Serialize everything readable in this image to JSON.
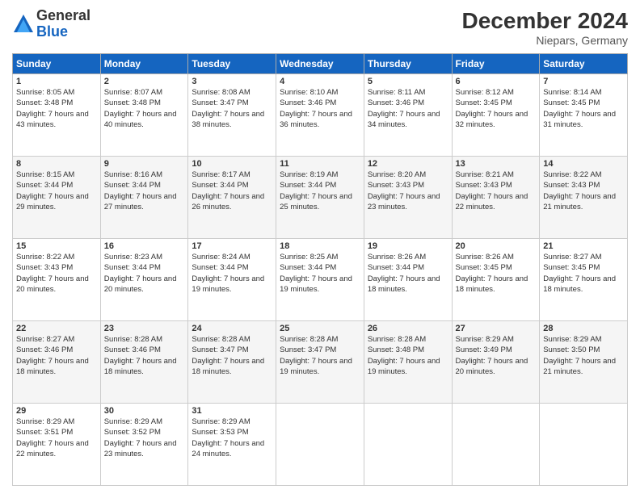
{
  "header": {
    "logo_general": "General",
    "logo_blue": "Blue",
    "month_title": "December 2024",
    "location": "Niepars, Germany"
  },
  "days_of_week": [
    "Sunday",
    "Monday",
    "Tuesday",
    "Wednesday",
    "Thursday",
    "Friday",
    "Saturday"
  ],
  "weeks": [
    [
      {
        "day": "1",
        "sunrise": "Sunrise: 8:05 AM",
        "sunset": "Sunset: 3:48 PM",
        "daylight": "Daylight: 7 hours and 43 minutes."
      },
      {
        "day": "2",
        "sunrise": "Sunrise: 8:07 AM",
        "sunset": "Sunset: 3:48 PM",
        "daylight": "Daylight: 7 hours and 40 minutes."
      },
      {
        "day": "3",
        "sunrise": "Sunrise: 8:08 AM",
        "sunset": "Sunset: 3:47 PM",
        "daylight": "Daylight: 7 hours and 38 minutes."
      },
      {
        "day": "4",
        "sunrise": "Sunrise: 8:10 AM",
        "sunset": "Sunset: 3:46 PM",
        "daylight": "Daylight: 7 hours and 36 minutes."
      },
      {
        "day": "5",
        "sunrise": "Sunrise: 8:11 AM",
        "sunset": "Sunset: 3:46 PM",
        "daylight": "Daylight: 7 hours and 34 minutes."
      },
      {
        "day": "6",
        "sunrise": "Sunrise: 8:12 AM",
        "sunset": "Sunset: 3:45 PM",
        "daylight": "Daylight: 7 hours and 32 minutes."
      },
      {
        "day": "7",
        "sunrise": "Sunrise: 8:14 AM",
        "sunset": "Sunset: 3:45 PM",
        "daylight": "Daylight: 7 hours and 31 minutes."
      }
    ],
    [
      {
        "day": "8",
        "sunrise": "Sunrise: 8:15 AM",
        "sunset": "Sunset: 3:44 PM",
        "daylight": "Daylight: 7 hours and 29 minutes."
      },
      {
        "day": "9",
        "sunrise": "Sunrise: 8:16 AM",
        "sunset": "Sunset: 3:44 PM",
        "daylight": "Daylight: 7 hours and 27 minutes."
      },
      {
        "day": "10",
        "sunrise": "Sunrise: 8:17 AM",
        "sunset": "Sunset: 3:44 PM",
        "daylight": "Daylight: 7 hours and 26 minutes."
      },
      {
        "day": "11",
        "sunrise": "Sunrise: 8:19 AM",
        "sunset": "Sunset: 3:44 PM",
        "daylight": "Daylight: 7 hours and 25 minutes."
      },
      {
        "day": "12",
        "sunrise": "Sunrise: 8:20 AM",
        "sunset": "Sunset: 3:43 PM",
        "daylight": "Daylight: 7 hours and 23 minutes."
      },
      {
        "day": "13",
        "sunrise": "Sunrise: 8:21 AM",
        "sunset": "Sunset: 3:43 PM",
        "daylight": "Daylight: 7 hours and 22 minutes."
      },
      {
        "day": "14",
        "sunrise": "Sunrise: 8:22 AM",
        "sunset": "Sunset: 3:43 PM",
        "daylight": "Daylight: 7 hours and 21 minutes."
      }
    ],
    [
      {
        "day": "15",
        "sunrise": "Sunrise: 8:22 AM",
        "sunset": "Sunset: 3:43 PM",
        "daylight": "Daylight: 7 hours and 20 minutes."
      },
      {
        "day": "16",
        "sunrise": "Sunrise: 8:23 AM",
        "sunset": "Sunset: 3:44 PM",
        "daylight": "Daylight: 7 hours and 20 minutes."
      },
      {
        "day": "17",
        "sunrise": "Sunrise: 8:24 AM",
        "sunset": "Sunset: 3:44 PM",
        "daylight": "Daylight: 7 hours and 19 minutes."
      },
      {
        "day": "18",
        "sunrise": "Sunrise: 8:25 AM",
        "sunset": "Sunset: 3:44 PM",
        "daylight": "Daylight: 7 hours and 19 minutes."
      },
      {
        "day": "19",
        "sunrise": "Sunrise: 8:26 AM",
        "sunset": "Sunset: 3:44 PM",
        "daylight": "Daylight: 7 hours and 18 minutes."
      },
      {
        "day": "20",
        "sunrise": "Sunrise: 8:26 AM",
        "sunset": "Sunset: 3:45 PM",
        "daylight": "Daylight: 7 hours and 18 minutes."
      },
      {
        "day": "21",
        "sunrise": "Sunrise: 8:27 AM",
        "sunset": "Sunset: 3:45 PM",
        "daylight": "Daylight: 7 hours and 18 minutes."
      }
    ],
    [
      {
        "day": "22",
        "sunrise": "Sunrise: 8:27 AM",
        "sunset": "Sunset: 3:46 PM",
        "daylight": "Daylight: 7 hours and 18 minutes."
      },
      {
        "day": "23",
        "sunrise": "Sunrise: 8:28 AM",
        "sunset": "Sunset: 3:46 PM",
        "daylight": "Daylight: 7 hours and 18 minutes."
      },
      {
        "day": "24",
        "sunrise": "Sunrise: 8:28 AM",
        "sunset": "Sunset: 3:47 PM",
        "daylight": "Daylight: 7 hours and 18 minutes."
      },
      {
        "day": "25",
        "sunrise": "Sunrise: 8:28 AM",
        "sunset": "Sunset: 3:47 PM",
        "daylight": "Daylight: 7 hours and 19 minutes."
      },
      {
        "day": "26",
        "sunrise": "Sunrise: 8:28 AM",
        "sunset": "Sunset: 3:48 PM",
        "daylight": "Daylight: 7 hours and 19 minutes."
      },
      {
        "day": "27",
        "sunrise": "Sunrise: 8:29 AM",
        "sunset": "Sunset: 3:49 PM",
        "daylight": "Daylight: 7 hours and 20 minutes."
      },
      {
        "day": "28",
        "sunrise": "Sunrise: 8:29 AM",
        "sunset": "Sunset: 3:50 PM",
        "daylight": "Daylight: 7 hours and 21 minutes."
      }
    ],
    [
      {
        "day": "29",
        "sunrise": "Sunrise: 8:29 AM",
        "sunset": "Sunset: 3:51 PM",
        "daylight": "Daylight: 7 hours and 22 minutes."
      },
      {
        "day": "30",
        "sunrise": "Sunrise: 8:29 AM",
        "sunset": "Sunset: 3:52 PM",
        "daylight": "Daylight: 7 hours and 23 minutes."
      },
      {
        "day": "31",
        "sunrise": "Sunrise: 8:29 AM",
        "sunset": "Sunset: 3:53 PM",
        "daylight": "Daylight: 7 hours and 24 minutes."
      },
      null,
      null,
      null,
      null
    ]
  ]
}
